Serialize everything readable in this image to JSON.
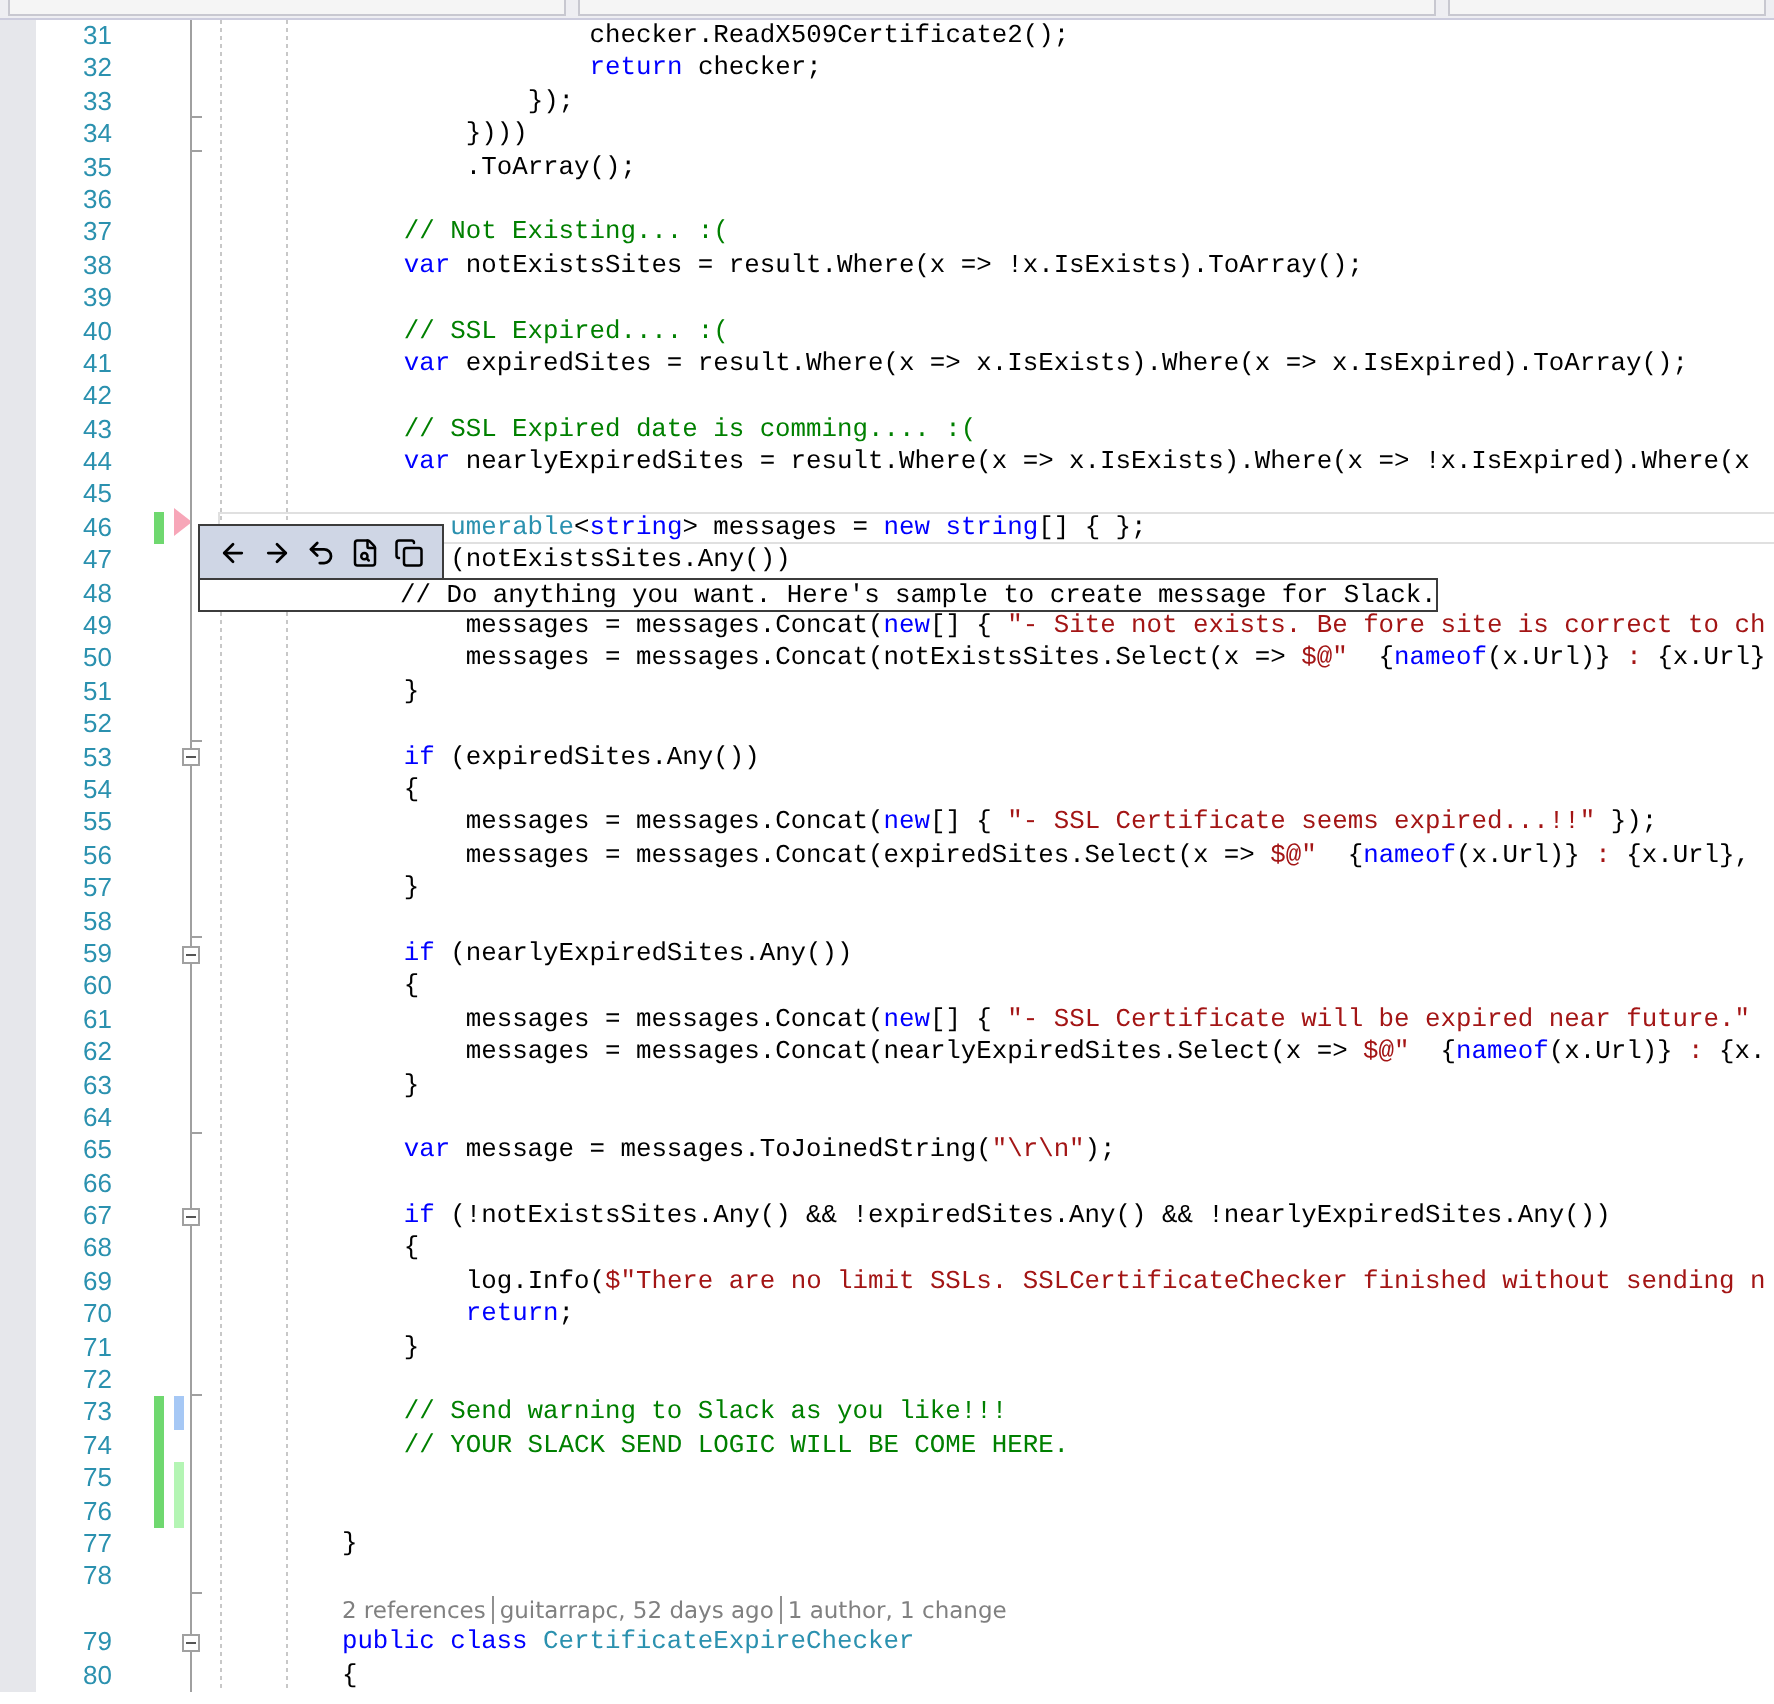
{
  "editor": {
    "lines": [
      {
        "number": "31",
        "current": false,
        "code": [
          {
            "kind": "plain",
            "text": "                    checker.ReadX509Certificate2();"
          }
        ]
      },
      {
        "number": "32",
        "current": false,
        "code": [
          {
            "kind": "keyword",
            "text": "                    return"
          },
          {
            "kind": "plain",
            "text": " checker;"
          }
        ]
      },
      {
        "number": "33",
        "current": false,
        "fold": {
          "kind": "end"
        },
        "code": [
          {
            "kind": "plain",
            "text": "                });"
          }
        ]
      },
      {
        "number": "34",
        "current": false,
        "fold": {
          "kind": "end"
        },
        "code": [
          {
            "kind": "plain",
            "text": "            })))"
          }
        ]
      },
      {
        "number": "35",
        "current": false,
        "code": [
          {
            "kind": "plain",
            "text": "            .ToArray();"
          }
        ]
      },
      {
        "number": "36",
        "current": false
      },
      {
        "number": "37",
        "current": false,
        "code": [
          {
            "kind": "comment",
            "text": "        // Not Existing... :("
          }
        ]
      },
      {
        "number": "38",
        "current": false,
        "code": [
          {
            "kind": "keyword",
            "text": "        var"
          },
          {
            "kind": "plain",
            "text": " notExistsSites = result.Where(x => !x.IsExists).ToArray();"
          }
        ]
      },
      {
        "number": "39",
        "current": false
      },
      {
        "number": "40",
        "current": false,
        "code": [
          {
            "kind": "comment",
            "text": "        // SSL Expired.... :("
          }
        ]
      },
      {
        "number": "41",
        "current": false,
        "code": [
          {
            "kind": "keyword",
            "text": "        var"
          },
          {
            "kind": "plain",
            "text": " expiredSites = result.Where(x => x.IsExists).Where(x => x.IsExpired).ToArray();"
          }
        ]
      },
      {
        "number": "42",
        "current": false
      },
      {
        "number": "43",
        "current": false,
        "code": [
          {
            "kind": "comment",
            "text": "        // SSL Expired date is comming.... :("
          }
        ]
      },
      {
        "number": "44",
        "current": false,
        "code": [
          {
            "kind": "keyword",
            "text": "        var"
          },
          {
            "kind": "plain",
            "text": " nearlyExpiredSites = result.Where(x => x.IsExists).Where(x => !x.IsExpired).Where(x"
          }
        ]
      },
      {
        "number": "45",
        "current": false
      },
      {
        "number": "46",
        "current": true,
        "changes": [
          {
            "color": "#6fd86f"
          }
        ],
        "code": [
          {
            "kind": "type",
            "text": "           umerable"
          },
          {
            "kind": "plain",
            "text": "<"
          },
          {
            "kind": "keyword",
            "text": "string"
          },
          {
            "kind": "plain",
            "text": "> messages = "
          },
          {
            "kind": "keyword",
            "text": "new string"
          },
          {
            "kind": "plain",
            "text": "[] { };"
          }
        ]
      },
      {
        "number": "47",
        "current": false,
        "code": [
          {
            "kind": "plain",
            "text": "           (notExistsSites.Any())"
          }
        ]
      },
      {
        "number": "48",
        "current": false
      },
      {
        "number": "49",
        "current": false,
        "code": [
          {
            "kind": "plain",
            "text": "            messages = messages.Concat("
          },
          {
            "kind": "keyword",
            "text": "new"
          },
          {
            "kind": "plain",
            "text": "[] { "
          },
          {
            "kind": "string",
            "text": "\"- Site not exists. Be fore site is correct to ch"
          }
        ]
      },
      {
        "number": "50",
        "current": false,
        "code": [
          {
            "kind": "plain",
            "text": "            messages = messages.Concat(notExistsSites.Select(x => "
          },
          {
            "kind": "string",
            "text": "$@\"  "
          },
          {
            "kind": "plain",
            "text": "{"
          },
          {
            "kind": "keyword",
            "text": "nameof"
          },
          {
            "kind": "plain",
            "text": "(x.Url)}"
          },
          {
            "kind": "string",
            "text": " : "
          },
          {
            "kind": "plain",
            "text": "{x.Url}"
          }
        ]
      },
      {
        "number": "51",
        "current": false,
        "code": [
          {
            "kind": "plain",
            "text": "        }"
          }
        ]
      },
      {
        "number": "52",
        "current": false,
        "fold": {
          "kind": "end"
        }
      },
      {
        "number": "53",
        "current": false,
        "fold": {
          "kind": "start"
        },
        "code": [
          {
            "kind": "keyword",
            "text": "        if"
          },
          {
            "kind": "plain",
            "text": " (expiredSites.Any())"
          }
        ]
      },
      {
        "number": "54",
        "current": false,
        "code": [
          {
            "kind": "plain",
            "text": "        {"
          }
        ]
      },
      {
        "number": "55",
        "current": false,
        "code": [
          {
            "kind": "plain",
            "text": "            messages = messages.Concat("
          },
          {
            "kind": "keyword",
            "text": "new"
          },
          {
            "kind": "plain",
            "text": "[] { "
          },
          {
            "kind": "string",
            "text": "\"- SSL Certificate seems expired...!!\""
          },
          {
            "kind": "plain",
            "text": " });"
          }
        ]
      },
      {
        "number": "56",
        "current": false,
        "code": [
          {
            "kind": "plain",
            "text": "            messages = messages.Concat(expiredSites.Select(x => "
          },
          {
            "kind": "string",
            "text": "$@\"  "
          },
          {
            "kind": "plain",
            "text": "{"
          },
          {
            "kind": "keyword",
            "text": "nameof"
          },
          {
            "kind": "plain",
            "text": "(x.Url)}"
          },
          {
            "kind": "string",
            "text": " : "
          },
          {
            "kind": "plain",
            "text": "{x.Url},"
          }
        ]
      },
      {
        "number": "57",
        "current": false,
        "code": [
          {
            "kind": "plain",
            "text": "        }"
          }
        ]
      },
      {
        "number": "58",
        "current": false,
        "fold": {
          "kind": "end"
        }
      },
      {
        "number": "59",
        "current": false,
        "fold": {
          "kind": "start"
        },
        "code": [
          {
            "kind": "keyword",
            "text": "        if"
          },
          {
            "kind": "plain",
            "text": " (nearlyExpiredSites.Any())"
          }
        ]
      },
      {
        "number": "60",
        "current": false,
        "code": [
          {
            "kind": "plain",
            "text": "        {"
          }
        ]
      },
      {
        "number": "61",
        "current": false,
        "code": [
          {
            "kind": "plain",
            "text": "            messages = messages.Concat("
          },
          {
            "kind": "keyword",
            "text": "new"
          },
          {
            "kind": "plain",
            "text": "[] { "
          },
          {
            "kind": "string",
            "text": "\"- SSL Certificate will be expired near future.\""
          }
        ]
      },
      {
        "number": "62",
        "current": false,
        "code": [
          {
            "kind": "plain",
            "text": "            messages = messages.Concat(nearlyExpiredSites.Select(x => "
          },
          {
            "kind": "string",
            "text": "$@\"  "
          },
          {
            "kind": "plain",
            "text": "{"
          },
          {
            "kind": "keyword",
            "text": "nameof"
          },
          {
            "kind": "plain",
            "text": "(x.Url)}"
          },
          {
            "kind": "string",
            "text": " : "
          },
          {
            "kind": "plain",
            "text": "{x."
          }
        ]
      },
      {
        "number": "63",
        "current": false,
        "code": [
          {
            "kind": "plain",
            "text": "        }"
          }
        ]
      },
      {
        "number": "64",
        "current": false,
        "fold": {
          "kind": "end"
        }
      },
      {
        "number": "65",
        "current": false,
        "code": [
          {
            "kind": "keyword",
            "text": "        var"
          },
          {
            "kind": "plain",
            "text": " message = messages.ToJoinedString("
          },
          {
            "kind": "string",
            "text": "\"\\r\\n\""
          },
          {
            "kind": "plain",
            "text": ");"
          }
        ]
      },
      {
        "number": "66",
        "current": false
      },
      {
        "number": "67",
        "current": false,
        "fold": {
          "kind": "start"
        },
        "code": [
          {
            "kind": "keyword",
            "text": "        if"
          },
          {
            "kind": "plain",
            "text": " (!notExistsSites.Any() && !expiredSites.Any() && !nearlyExpiredSites.Any())"
          }
        ]
      },
      {
        "number": "68",
        "current": false,
        "code": [
          {
            "kind": "plain",
            "text": "        {"
          }
        ]
      },
      {
        "number": "69",
        "current": false,
        "code": [
          {
            "kind": "plain",
            "text": "            log.Info("
          },
          {
            "kind": "string",
            "text": "$\"There are no limit SSLs. SSLCertificateChecker finished without sending n"
          }
        ]
      },
      {
        "number": "70",
        "current": false,
        "code": [
          {
            "kind": "keyword",
            "text": "            return"
          },
          {
            "kind": "plain",
            "text": ";"
          }
        ]
      },
      {
        "number": "71",
        "current": false,
        "code": [
          {
            "kind": "plain",
            "text": "        }"
          }
        ]
      },
      {
        "number": "72",
        "current": false,
        "fold": {
          "kind": "end"
        }
      },
      {
        "number": "73",
        "current": false,
        "changes": [
          {
            "color": "#6fd86f"
          },
          {
            "color": "#a6c8f5"
          }
        ],
        "code": [
          {
            "kind": "comment",
            "text": "        // Send warning to Slack as you like!!!"
          }
        ]
      },
      {
        "number": "74",
        "current": false,
        "changes": [
          {
            "color": "#6fd86f"
          }
        ],
        "code": [
          {
            "kind": "comment",
            "text": "        // YOUR SLACK SEND LOGIC WILL BE COME HERE."
          }
        ]
      },
      {
        "number": "75",
        "current": false,
        "changes": [
          {
            "color": "#6fd86f"
          },
          {
            "color": "#b4f5b4"
          }
        ]
      },
      {
        "number": "76",
        "current": false,
        "changes": [
          {
            "color": "#6fd86f"
          },
          {
            "color": "#b4f5b4"
          }
        ]
      },
      {
        "number": "77",
        "current": false,
        "code": [
          {
            "kind": "plain",
            "text": "    }"
          }
        ]
      },
      {
        "number": "78",
        "current": false,
        "fold": {
          "kind": "end"
        }
      },
      {
        "number": "79",
        "current": false,
        "fold": {
          "kind": "start"
        },
        "lens": [
          "2 references",
          "guitarrapc, 52 days ago",
          "1 author, 1 change"
        ],
        "code": [
          {
            "kind": "keyword",
            "text": "    public class"
          },
          {
            "kind": "type",
            "text": " CertificateExpireChecker"
          }
        ]
      },
      {
        "number": "80",
        "current": false,
        "code": [
          {
            "kind": "plain",
            "text": "    {"
          }
        ]
      }
    ]
  },
  "peek_tooltip": {
    "text": "// Do anything you want. Here's sample to create message for Slack."
  }
}
